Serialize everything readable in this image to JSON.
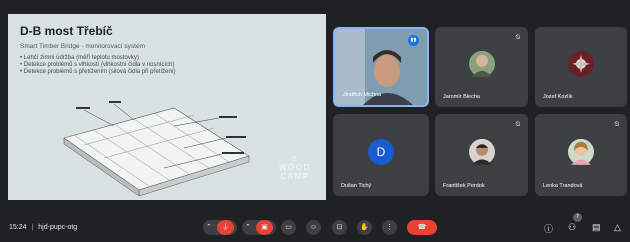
{
  "slide": {
    "title": "D-B most Třebíč",
    "subtitle": "Smart Timber Bridge - monitorovací systém",
    "bullets": [
      "Lehčí zimní údržba (měří teplotu mostovky)",
      "Detekce problémů s vlhkostí (vlhkostní čidla v nosnících)",
      "Detekce problémů s přetížením (silová čidla při přetížení)"
    ],
    "logo_line1": "WOOD",
    "logo_line2": "CAMP"
  },
  "participants": [
    {
      "name": "Jindřich Michna",
      "muted": false,
      "speaking": true
    },
    {
      "name": "Jaromír Blecha",
      "muted": true
    },
    {
      "name": "Jozef Kozlík",
      "muted": false
    },
    {
      "name": "Dušan Tichý",
      "muted": false,
      "initial": "D"
    },
    {
      "name": "František Perdok",
      "muted": true
    },
    {
      "name": "Lenka Trandová",
      "muted": true
    }
  ],
  "meeting": {
    "time": "15:24",
    "separator": "|",
    "code": "hjd-pupc-otg",
    "participant_count": "7"
  },
  "colors": {
    "background": "#202124",
    "tile": "#3c4043",
    "danger": "#ea4335",
    "accent": "#1a73e8",
    "avatar_d": "#1a5ccf"
  },
  "icons": {
    "chevron": "chevron-up-icon",
    "mic": "mic-off-icon",
    "camera": "camera-off-icon",
    "captions": "captions-icon",
    "emoji": "emoji-icon",
    "present": "present-icon",
    "hand": "raise-hand-icon",
    "more": "more-icon",
    "end_call": "end-call-icon",
    "info": "info-icon",
    "people": "people-icon",
    "chat": "chat-icon",
    "activities": "activities-icon"
  }
}
